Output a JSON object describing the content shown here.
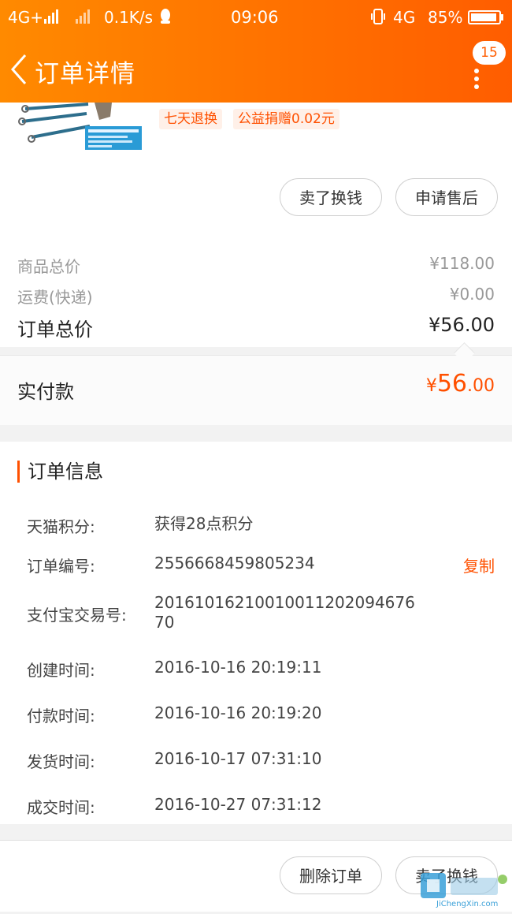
{
  "status_bar": {
    "network1": "4G+",
    "net_speed": "0.1K/s",
    "time": "09:06",
    "network2": "4G",
    "battery": "85%"
  },
  "nav": {
    "title": "订单详情",
    "badge": "15"
  },
  "product": {
    "tags": [
      "七天退换",
      "公益捐赠0.02元"
    ],
    "buttons": [
      "卖了换钱",
      "申请售后"
    ]
  },
  "prices": {
    "goods_label": "商品总价",
    "goods_value": "¥118.00",
    "shipping_label": "运费(快递)",
    "shipping_value": "¥0.00",
    "order_total_label": "订单总价",
    "order_total_value": "¥56.00",
    "paid_label": "实付款",
    "paid_currency": "¥",
    "paid_int": "56",
    "paid_dec": ".00"
  },
  "order_info": {
    "title": "订单信息",
    "rows": [
      {
        "label": "天猫积分:",
        "value": "获得28点积分"
      },
      {
        "label": "订单编号:",
        "value": "2556668459805234"
      },
      {
        "label": "支付宝交易号:",
        "value": "2016101621001001120209467670"
      },
      {
        "label": "创建时间:",
        "value": "2016-10-16 20:19:11"
      },
      {
        "label": "付款时间:",
        "value": "2016-10-16 20:19:20"
      },
      {
        "label": "发货时间:",
        "value": "2016-10-17 07:31:10"
      },
      {
        "label": "成交时间:",
        "value": "2016-10-27 07:31:12"
      }
    ],
    "copy_label": "复制"
  },
  "bottom_bar": {
    "buttons": [
      "删除订单",
      "卖了换钱"
    ]
  },
  "colors": {
    "accent": "#ff5000",
    "header_start": "#ff8a00",
    "header_end": "#ff5d00"
  },
  "watermark": {
    "text": "JiChengXin.com"
  }
}
